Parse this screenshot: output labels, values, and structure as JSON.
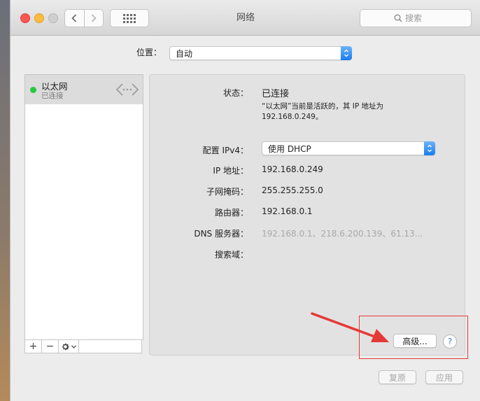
{
  "window": {
    "title": "网络"
  },
  "toolbar": {
    "back_icon": "chevron-left-icon",
    "forward_icon": "chevron-right-icon",
    "show_all_icon": "grid-icon",
    "search_placeholder": "搜索"
  },
  "location": {
    "label": "位置：",
    "value": "自动"
  },
  "interfaces": [
    {
      "name": "以太网",
      "status": "已连接",
      "status_color": "#27c93f",
      "icon": "ethernet-icon"
    }
  ],
  "list_toolbar": {
    "add": "+",
    "remove": "−",
    "gear_icon": "gear-icon"
  },
  "detail": {
    "status_label": "状态：",
    "status_value": "已连接",
    "status_note_line1": "“以太网”当前是活跃的，其 IP 地址为",
    "status_note_line2": "192.168.0.249。",
    "ipv4_config_label": "配置 IPv4：",
    "ipv4_config_value": "使用 DHCP",
    "ip_label": "IP 地址：",
    "ip_value": "192.168.0.249",
    "subnet_label": "子网掩码：",
    "subnet_value": "255.255.255.0",
    "router_label": "路由器：",
    "router_value": "192.168.0.1",
    "dns_label": "DNS 服务器：",
    "dns_value": "192.168.0.1、218.6.200.139、61.13...",
    "search_domain_label": "搜索域："
  },
  "buttons": {
    "advanced": "高级...",
    "help": "?",
    "revert": "复原",
    "apply": "应用"
  },
  "colors": {
    "accent": "#1a7bf0",
    "annotation": "#e53935"
  }
}
